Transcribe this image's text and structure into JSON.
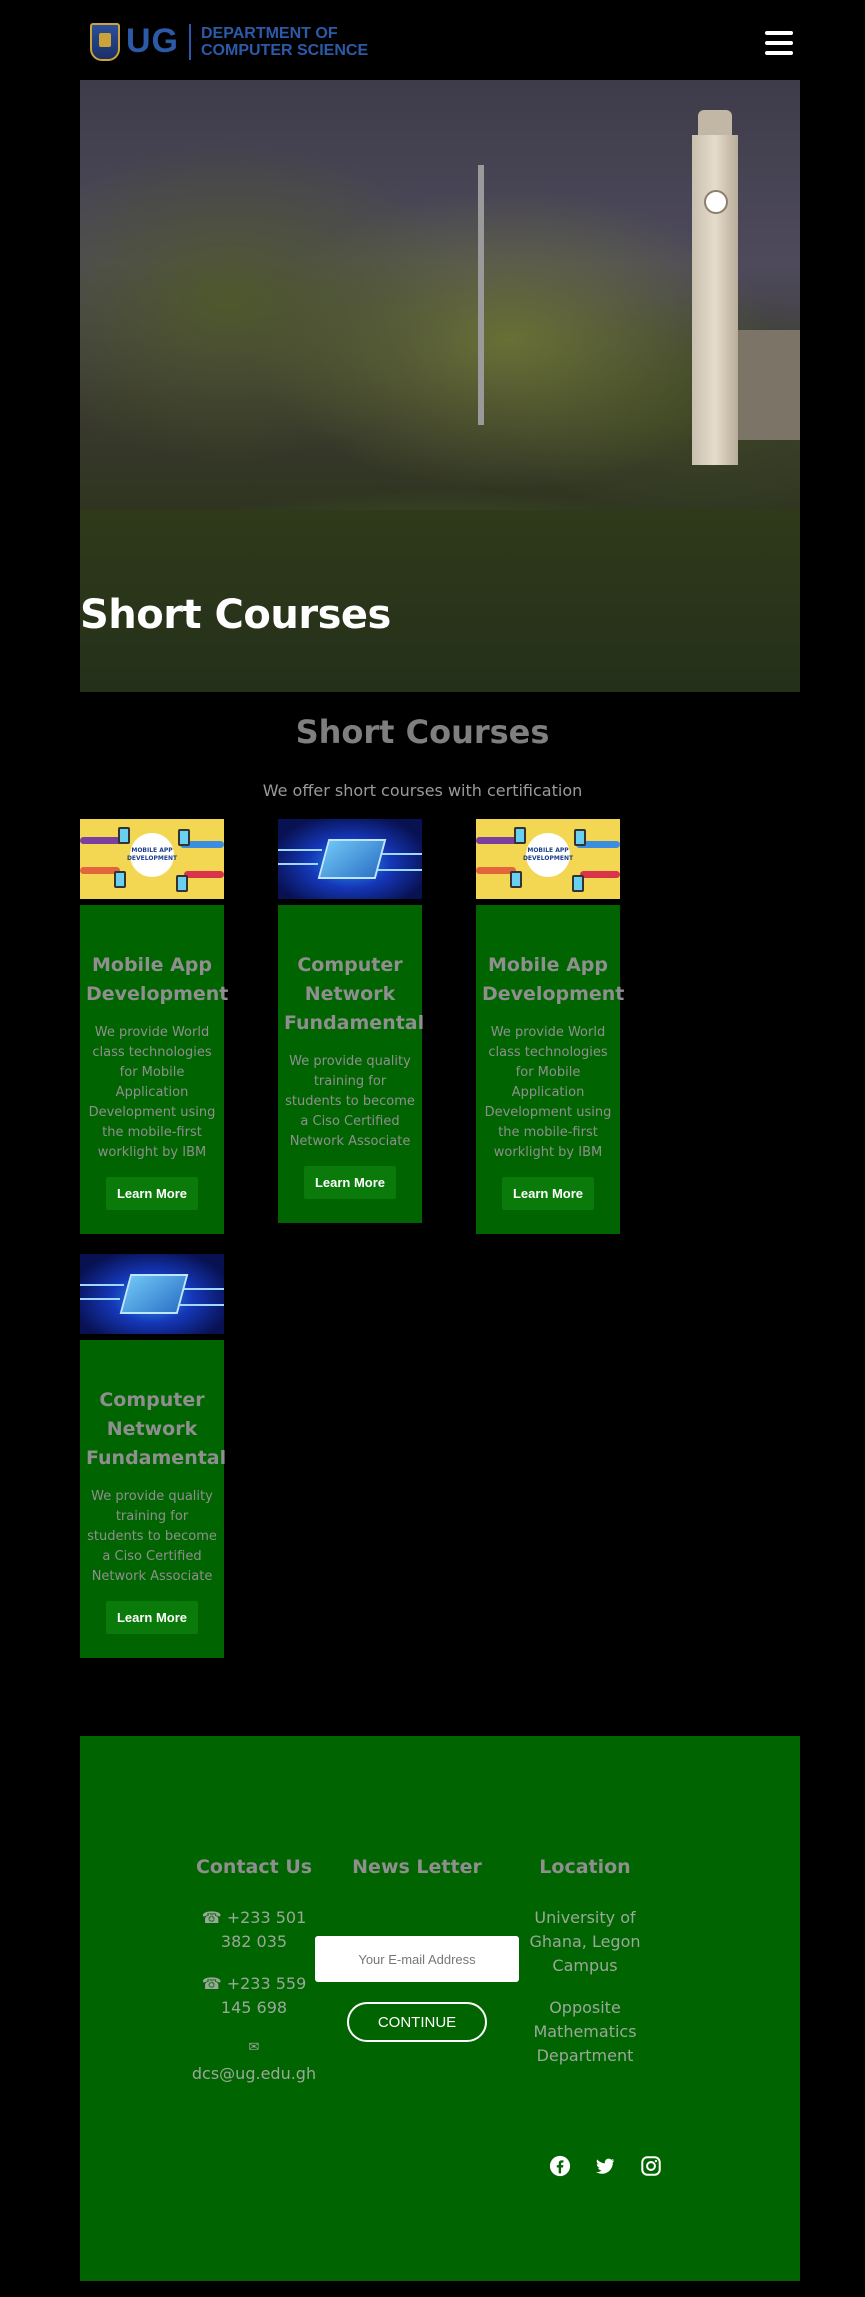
{
  "header": {
    "logo_text": "UG",
    "dept_line1": "DEPARTMENT OF",
    "dept_line2": "COMPUTER SCIENCE"
  },
  "hero": {
    "title": "Short Courses"
  },
  "section": {
    "title": "Short Courses",
    "subtitle": "We offer short courses with certification"
  },
  "courses": [
    {
      "image": "mobile-app-development-image",
      "image_caption": "MOBILE APP DEVELOPMENT",
      "title": "Mobile App Development",
      "description": "We provide World class technologies for Mobile Application Development using the mobile-first worklight by IBM",
      "button": "Learn More"
    },
    {
      "image": "circuit-chip-image",
      "title": "Computer Network Fundamental",
      "description": "We provide quality training for students to become a Ciso Certified Network Associate",
      "button": "Learn More"
    },
    {
      "image": "mobile-app-development-image",
      "image_caption": "MOBILE APP DEVELOPMENT",
      "title": "Mobile App Development",
      "description": "We provide World class technologies for Mobile Application Development using the mobile-first worklight by IBM",
      "button": "Learn More"
    },
    {
      "image": "circuit-chip-image",
      "title": "Computer Network Fundamental",
      "description": "We provide quality training for students to become a Ciso Certified Network Associate",
      "button": "Learn More"
    }
  ],
  "footer": {
    "contact": {
      "title": "Contact Us",
      "phone1": "☎ +233 501 382 035",
      "phone2": "☎ +233 559 145 698",
      "email_icon": "✉",
      "email": "dcs@ug.edu.gh"
    },
    "newsletter": {
      "title": "News Letter",
      "placeholder": "Your E-mail Address",
      "button": "CONTINUE"
    },
    "location": {
      "title": "Location",
      "line1": "University of Ghana, Legon Campus",
      "line2": "Opposite Mathematics Department"
    },
    "social_icons": [
      "facebook-icon",
      "twitter-icon",
      "instagram-icon"
    ]
  },
  "colors": {
    "background": "#000000",
    "green_panel": "#006400",
    "button_green": "#0a7a0a",
    "heading_gray": "#8f8f8f",
    "logo_blue": "#2d5aa8"
  }
}
